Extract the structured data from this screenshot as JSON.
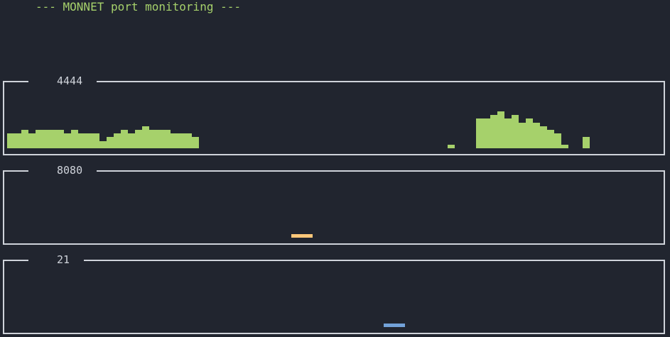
{
  "title": "--- MONNET port monitoring ---",
  "panels": [
    {
      "port": "4444",
      "color": "#a6d16b",
      "chart_data": {
        "type": "bar",
        "values": [
          4,
          4,
          5,
          4,
          5,
          5,
          5,
          5,
          4,
          5,
          4,
          4,
          4,
          2,
          3,
          4,
          5,
          4,
          5,
          6,
          5,
          5,
          5,
          4,
          4,
          4,
          3,
          0,
          0,
          0,
          0,
          0,
          0,
          0,
          0,
          0,
          0,
          0,
          0,
          0,
          0,
          0,
          0,
          0,
          0,
          0,
          0,
          0,
          0,
          0,
          0,
          0,
          0,
          0,
          0,
          0,
          0,
          0,
          0,
          0,
          0,
          0,
          1,
          0,
          0,
          0,
          8,
          8,
          9,
          10,
          8,
          9,
          7,
          8,
          7,
          6,
          5,
          4,
          1,
          0,
          0,
          3
        ],
        "ylim": [
          0,
          13
        ]
      }
    },
    {
      "port": "8080",
      "color": "#fec77a",
      "chart_data": {
        "type": "bar",
        "values": [
          0,
          0,
          0,
          0,
          0,
          0,
          0,
          0,
          0,
          0,
          0,
          0,
          0,
          0,
          0,
          0,
          0,
          0,
          0,
          0,
          0,
          0,
          0,
          0,
          0,
          0,
          0,
          0,
          0,
          0,
          0,
          0,
          0,
          0,
          0,
          0,
          0,
          0,
          0,
          0,
          1,
          1,
          1
        ],
        "ylim": [
          0,
          13
        ]
      }
    },
    {
      "port": "21",
      "color": "#73a2d9",
      "chart_data": {
        "type": "bar",
        "values": [
          0,
          0,
          0,
          0,
          0,
          0,
          0,
          0,
          0,
          0,
          0,
          0,
          0,
          0,
          0,
          0,
          0,
          0,
          0,
          0,
          0,
          0,
          0,
          0,
          0,
          0,
          0,
          0,
          0,
          0,
          0,
          0,
          0,
          0,
          0,
          0,
          0,
          0,
          0,
          0,
          0,
          0,
          0,
          0,
          0,
          0,
          0,
          0,
          0,
          0,
          0,
          0,
          0,
          1,
          1,
          1
        ],
        "ylim": [
          0,
          13
        ]
      }
    }
  ]
}
